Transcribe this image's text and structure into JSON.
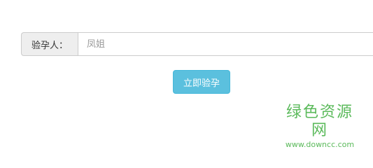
{
  "form": {
    "label": "验孕人：",
    "input_placeholder": "凤姐",
    "input_value": ""
  },
  "submit": {
    "label": "立即验孕"
  },
  "watermark": {
    "brand": "绿色资源网",
    "url": "www.downcc.com"
  },
  "colors": {
    "button_bg": "#5bc0de",
    "addon_bg": "#eeeeee",
    "watermark": "#3fae3f"
  }
}
